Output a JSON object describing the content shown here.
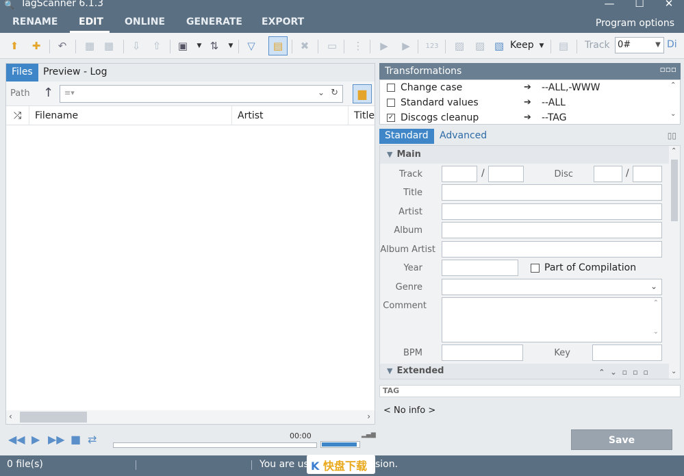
{
  "window": {
    "title": "TagScanner 6.1.3",
    "minimize": "—",
    "maximize": "☐",
    "close": "✕"
  },
  "menu": {
    "tabs": [
      "RENAME",
      "EDIT",
      "ONLINE",
      "GENERATE",
      "EXPORT"
    ],
    "active": "EDIT",
    "program_options": "Program options"
  },
  "toolbar": {
    "keep_label": "Keep",
    "track_label": "Track",
    "track_value": "0#",
    "disc_fragment": "Di"
  },
  "left_panel": {
    "tabs": [
      "Files",
      "Preview - Log"
    ],
    "active_tab": "Files",
    "path_label": "Path",
    "path_value": "",
    "columns": [
      "Filename",
      "Artist",
      "Title"
    ]
  },
  "player": {
    "time": "00:00",
    "volume_fraction": 0.95
  },
  "transformations": {
    "title": "Transformations",
    "items": [
      {
        "name": "Change case",
        "value": "--ALL,-WWW",
        "checked": false
      },
      {
        "name": "Standard values",
        "value": "--ALL",
        "checked": false
      },
      {
        "name": "Discogs cleanup",
        "value": "--TAG",
        "checked": true
      }
    ]
  },
  "editor": {
    "tabs": [
      "Standard",
      "Advanced"
    ],
    "active_tab": "Standard",
    "sections": {
      "main": "Main",
      "extended": "Extended"
    },
    "fields": {
      "track": "Track",
      "disc": "Disc",
      "title": "Title",
      "artist": "Artist",
      "album": "Album",
      "album_artist": "Album Artist",
      "year": "Year",
      "compilation": "Part of Compilation",
      "genre": "Genre",
      "comment": "Comment",
      "bpm": "BPM",
      "key": "Key"
    }
  },
  "tag_area": {
    "header": "TAG",
    "info": "< No info >"
  },
  "save_button": "Save",
  "status": {
    "file_count": "0 file(s)",
    "message": "You are usi",
    "message_tail": "sion."
  },
  "watermark": {
    "text": "快盘下载"
  }
}
